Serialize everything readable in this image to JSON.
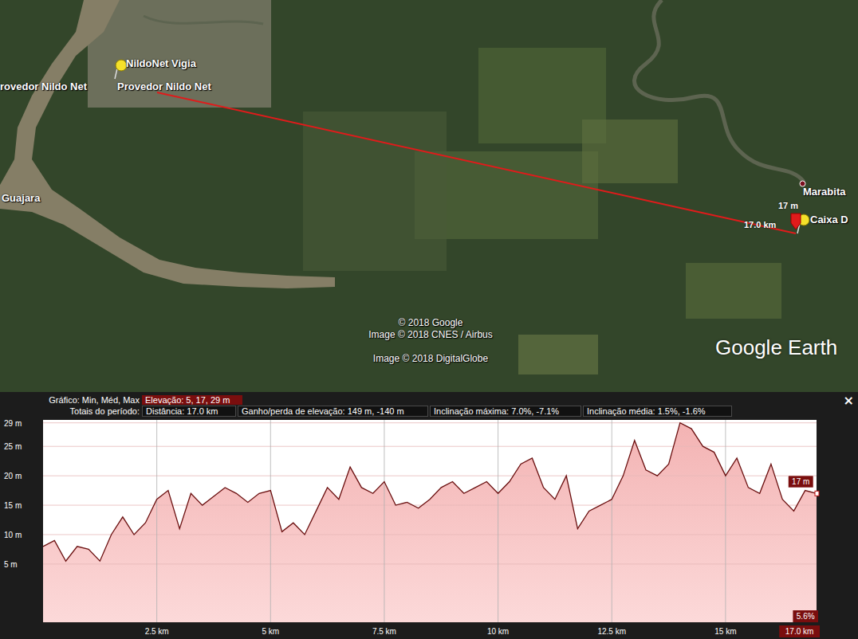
{
  "map": {
    "placemarks": [
      {
        "label": "NildoNet Vigia",
        "kind": "pushpin"
      },
      {
        "label": "rovedor Nildo Net",
        "kind": "label"
      },
      {
        "label": "Provedor Nildo Net",
        "kind": "label"
      },
      {
        "label": "Guajara",
        "kind": "label"
      },
      {
        "label": "Marabita",
        "kind": "dot"
      },
      {
        "label": "Caixa D",
        "kind": "pushpin"
      }
    ],
    "path": {
      "height_label": "17 m",
      "distance_label": "17.0 km"
    },
    "attribution": [
      "© 2018 Google",
      "Image © 2018 CNES / Airbus",
      "Image © 2018 DigitalGlobe"
    ],
    "logo": "Google Earth"
  },
  "profile": {
    "close": "×",
    "summary_label": "Gráfico: Min, Méd, Max",
    "summary_value": "Elevação: 5, 17, 29 m",
    "totals_label": "Totais do período:",
    "totals": [
      "Distância: 17.0 km",
      "Ganho/perda de elevação: 149 m, -140 m",
      "Inclinação máxima: 7.0%, -7.1%",
      "Inclinação média: 1.5%, -1.6%"
    ],
    "y_ticks": [
      {
        "label": "29 m",
        "value": 29
      },
      {
        "label": "25 m",
        "value": 25
      },
      {
        "label": "20 m",
        "value": 20
      },
      {
        "label": "15 m",
        "value": 15
      },
      {
        "label": "10 m",
        "value": 10
      },
      {
        "label": "5 m",
        "value": 5
      }
    ],
    "x_ticks": [
      {
        "label": "2.5 km",
        "value": 2.5
      },
      {
        "label": "5 km",
        "value": 5
      },
      {
        "label": "7.5 km",
        "value": 7.5
      },
      {
        "label": "10 km",
        "value": 10
      },
      {
        "label": "12.5 km",
        "value": 12.5
      },
      {
        "label": "15 km",
        "value": 15
      }
    ],
    "series": {
      "name": "Elevação",
      "start_km": 0,
      "step_km": 0.25,
      "values": [
        8,
        9,
        5.5,
        8,
        7.5,
        5.5,
        10,
        13,
        10,
        12,
        16,
        17.5,
        11,
        17,
        15,
        16.5,
        18,
        17,
        15.5,
        17,
        17.5,
        10.5,
        12,
        10,
        14,
        18,
        16,
        21.5,
        18,
        17,
        19,
        15,
        15.5,
        14.5,
        16,
        18,
        19,
        17,
        18,
        19,
        17,
        19,
        22,
        23,
        18,
        16,
        20,
        11,
        14,
        15,
        16,
        20,
        26,
        21,
        20,
        22,
        29,
        28,
        25,
        24,
        20,
        23,
        18,
        17,
        22,
        16,
        14,
        17.5,
        17
      ]
    },
    "cursor": {
      "elevation": "17 m",
      "slope": "5.6%",
      "distance": "17.0 km"
    }
  }
}
